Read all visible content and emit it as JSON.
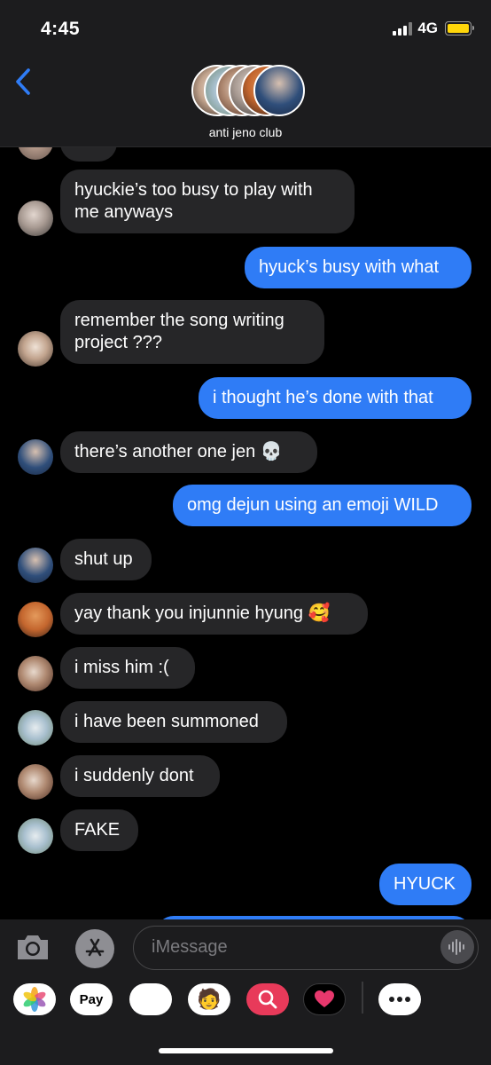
{
  "status": {
    "time": "4:45",
    "network": "4G"
  },
  "header": {
    "group_name": "anti jeno club"
  },
  "messages": [
    {
      "text": "hyuckie’s too busy to play with\nme anyways"
    },
    {
      "text": "hyuck’s busy with what"
    },
    {
      "text": "remember the song writing\nproject ???"
    },
    {
      "text": "i thought he’s done with that"
    },
    {
      "text": "there’s another one jen 💀"
    },
    {
      "text": "omg dejun using an emoji WILD"
    },
    {
      "text": "shut up"
    },
    {
      "text": "yay thank you injunnie hyung 🥰"
    },
    {
      "text": "i miss him :("
    },
    {
      "text": "i have been summoned"
    },
    {
      "text": "i suddenly dont"
    },
    {
      "text": "FAKE"
    },
    {
      "text": "HYUCK"
    }
  ],
  "input": {
    "placeholder": "iMessage"
  },
  "app_drawer": {
    "apple_pay_label": "Pay"
  },
  "colors": {
    "outgoing": "#2f7cf6",
    "incoming": "#262628",
    "accent": "#2f7cf6",
    "battery": "#ffd60a"
  },
  "icons": [
    "back-chevron-icon",
    "camera-icon",
    "app-store-icon",
    "audio-waveform-icon",
    "photos-app-icon",
    "apple-pay-icon",
    "monkey-emoji-icon",
    "memoji-icon",
    "search-images-icon",
    "heart-sticker-icon",
    "more-apps-icon"
  ]
}
